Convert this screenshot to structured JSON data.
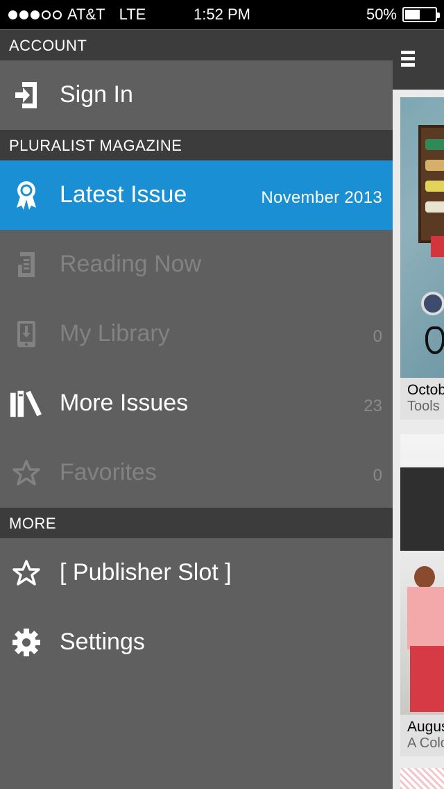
{
  "status_bar": {
    "carrier": "AT&T",
    "network": "LTE",
    "time": "1:52 PM",
    "battery": "50%",
    "battery_level": 0.5,
    "signal_bars": 3
  },
  "sections": {
    "account": "ACCOUNT",
    "magazine": "PLURALIST MAGAZINE",
    "more": "MORE"
  },
  "items": {
    "sign_in": {
      "label": "Sign In",
      "icon": "sign-in-icon"
    },
    "latest_issue": {
      "label": "Latest Issue",
      "value": "November 2013",
      "icon": "ribbon-award-icon"
    },
    "reading_now": {
      "label": "Reading Now",
      "icon": "document-icon"
    },
    "my_library": {
      "label": "My Library",
      "value": "0",
      "icon": "device-download-icon"
    },
    "more_issues": {
      "label": "More Issues",
      "value": "23",
      "icon": "books-icon"
    },
    "favorites": {
      "label": "Favorites",
      "value": "0",
      "icon": "star-outline-icon"
    },
    "publisher_slot": {
      "label": "[ Publisher Slot ]",
      "icon": "star-outline-icon"
    },
    "settings": {
      "label": "Settings",
      "icon": "gear-icon"
    }
  },
  "cards": [
    {
      "title": "Octob",
      "subtitle": "Tools"
    },
    {
      "title": "Augus",
      "subtitle": "A Colo"
    }
  ],
  "colors": {
    "accent": "#1a8fd4",
    "menu_bg": "#5f5f5f",
    "header_bg": "#3c3c3c"
  }
}
